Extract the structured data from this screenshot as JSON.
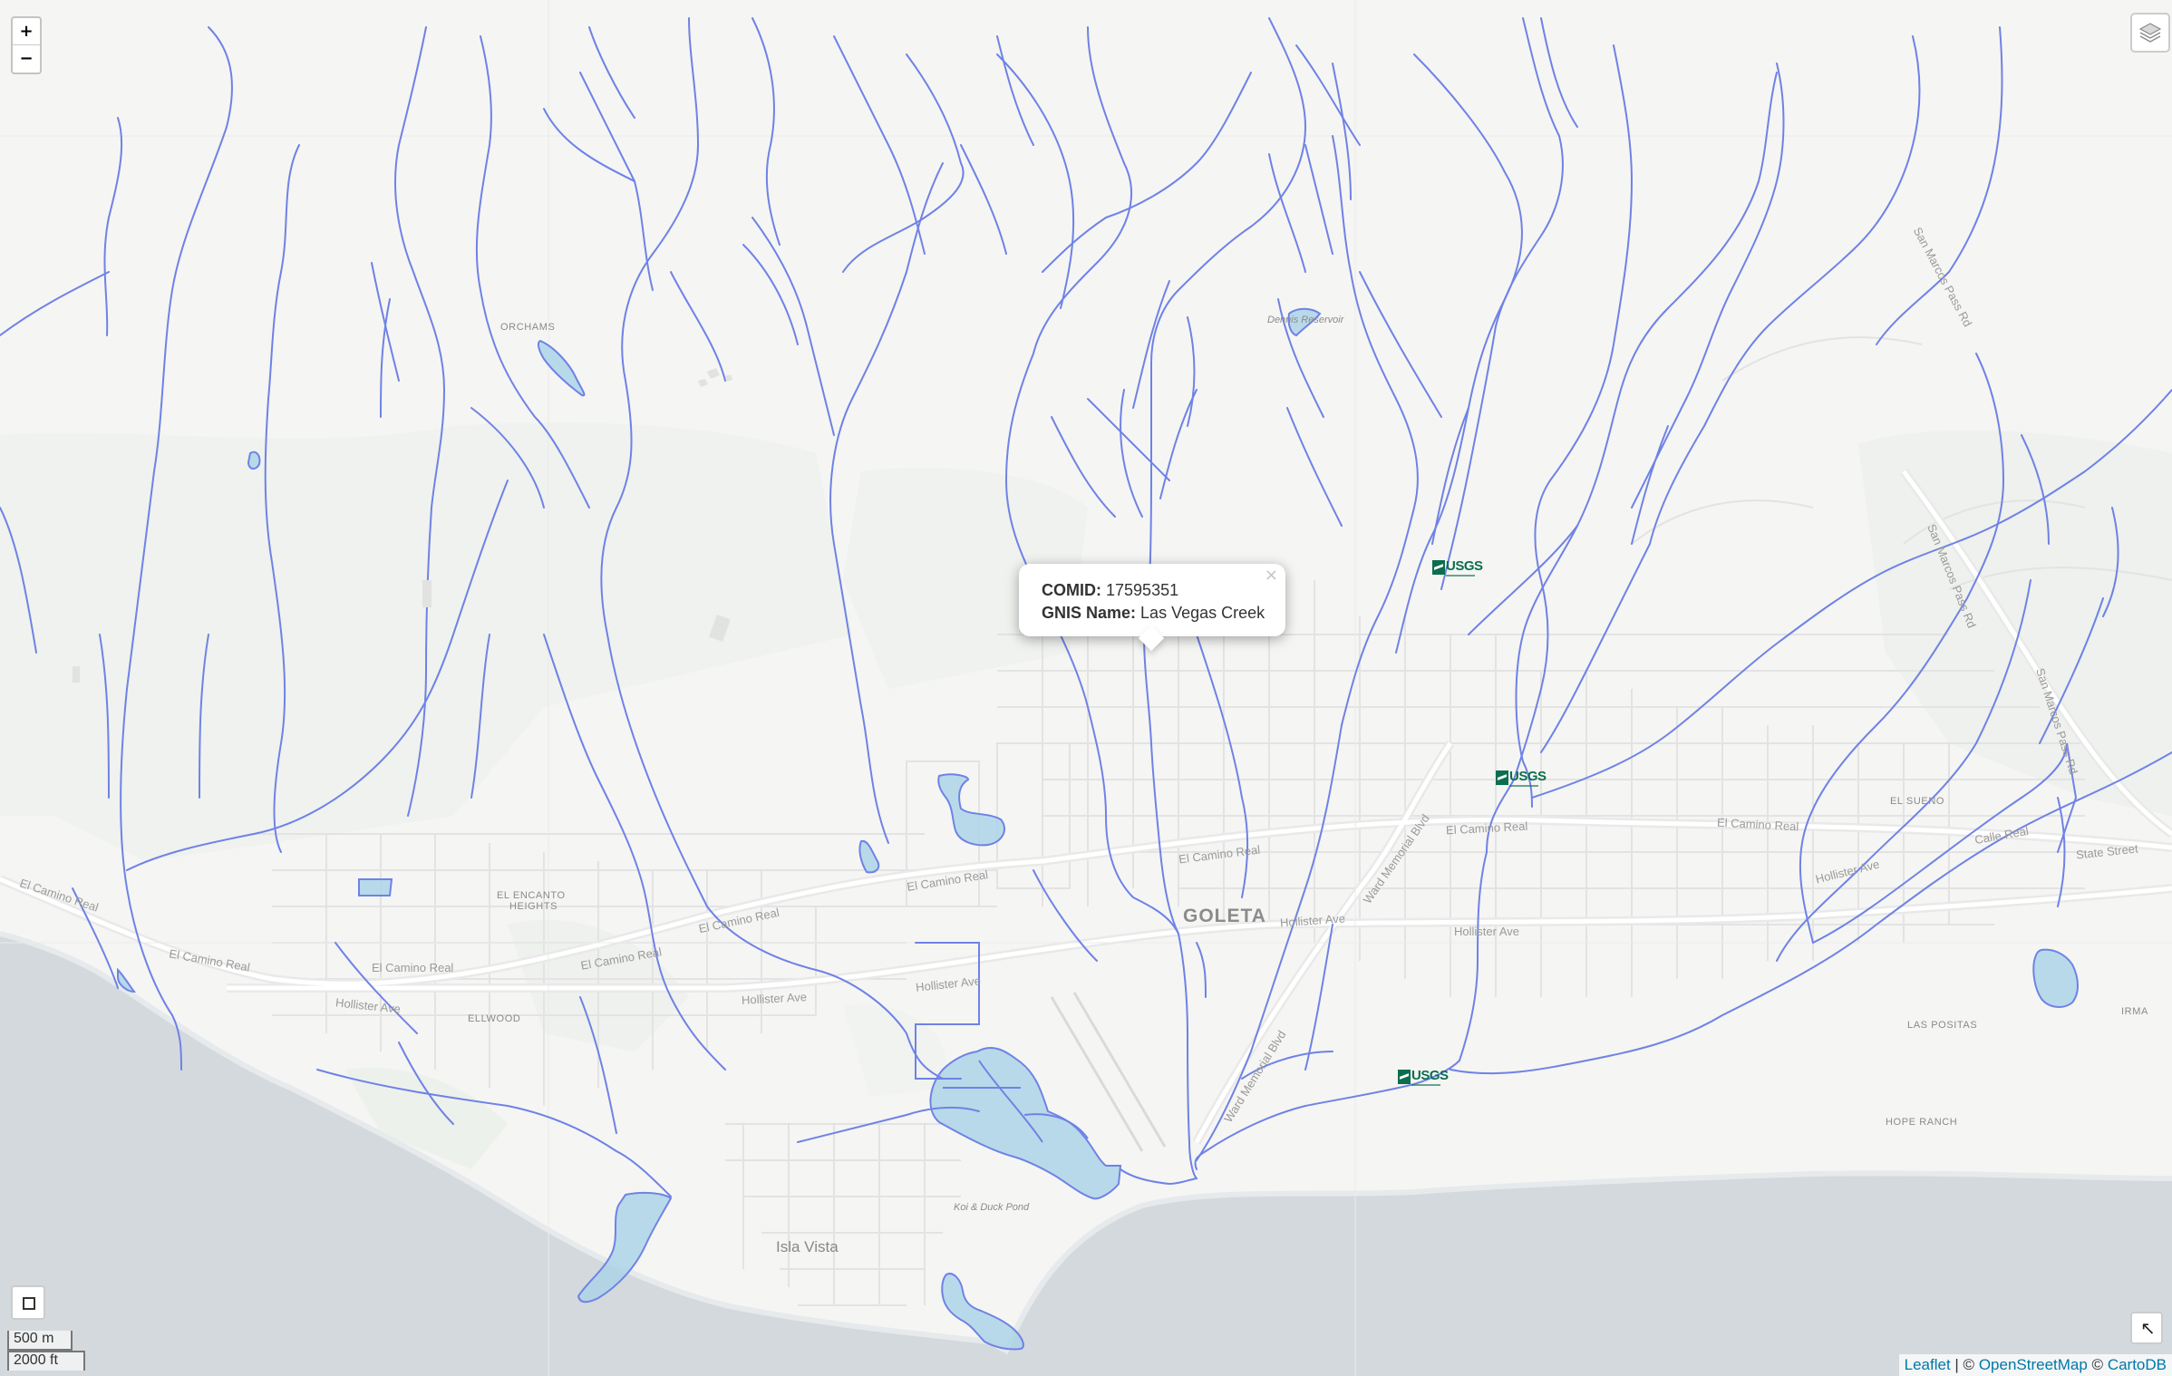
{
  "map": {
    "provider_attribution": {
      "leaflet": "Leaflet",
      "sep1": " | © ",
      "osm": "OpenStreetMap",
      "sep2": " © ",
      "carto": "CartoDB"
    },
    "zoom_in_label": "+",
    "zoom_out_label": "−",
    "scale": {
      "metric": "500 m",
      "imperial": "2000 ft"
    },
    "popup": {
      "comid_label": "COMID:",
      "comid_value": "17595351",
      "gnis_label": "GNIS Name:",
      "gnis_value": "Las Vegas Creek",
      "close_symbol": "×"
    },
    "usgs_label": "USGS",
    "colors": {
      "flowline": "#6f82e6",
      "waterbody_fill": "#a9d2e6",
      "waterbody_stroke": "#6f82e6",
      "ocean": "#d4d9dd",
      "land": "#f5f5f3",
      "usgs_green": "#0b6e4f"
    },
    "labels": {
      "goleta": "GOLETA",
      "isla_vista": "Isla Vista",
      "orchams": "ORCHAMS",
      "el_encanto_1": "EL ENCANTO",
      "el_encanto_2": "HEIGHTS",
      "ellwood": "ELLWOOD",
      "el_sueno": "EL SUENO",
      "las_positas": "LAS POSITAS",
      "hope_ranch": "HOPE RANCH",
      "irma": "IRMA",
      "dennis_reservoir": "Dennis Reservoir",
      "koi_duck_pond": "Koi & Duck Pond",
      "el_camino_real": "El Camino Real",
      "hollister_ave": "Hollister Ave",
      "ward_memorial_blvd": "Ward Memorial Blvd",
      "san_marcos_pass_rd": "San Marcos Pass Rd",
      "state_street": "State Street",
      "calle_real": "Calle Real"
    }
  }
}
